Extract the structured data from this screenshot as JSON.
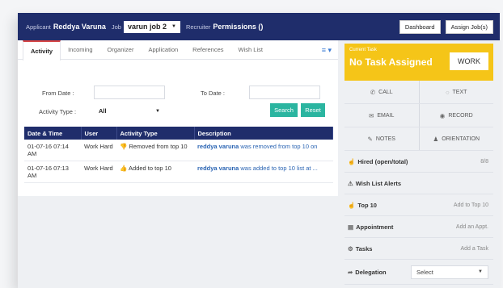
{
  "header": {
    "applicant_label": "Applicant",
    "applicant_name": "Reddya Varuna",
    "job_label": "Job",
    "job_value": "varun job 2",
    "recruiter_label": "Recruiter",
    "recruiter_value": "Permissions ()",
    "dashboard_button": "Dashboard",
    "assign_button": "Assign Job(s)"
  },
  "tabs": [
    "Activity",
    "Incoming",
    "Organizer",
    "Application",
    "References",
    "Wish List"
  ],
  "filters": {
    "from_label": "From Date :",
    "to_label": "To Date :",
    "type_label": "Activity Type :",
    "type_value": "All",
    "search_button": "Search",
    "reset_button": "Reset"
  },
  "table": {
    "columns": [
      "Date & Time",
      "User",
      "Activity Type",
      "Description"
    ],
    "rows": [
      {
        "date": "01-07-16 07:14 AM",
        "user": "Work Hard",
        "type": "Removed from top 10",
        "desc_user": "reddya varuna",
        "desc_text": " was removed from top 10 on"
      },
      {
        "date": "01-07-16 07:13 AM",
        "user": "Work Hard",
        "type": "Added to top 10",
        "desc_user": "reddya varuna",
        "desc_text": " was added to top 10 list at ..."
      }
    ]
  },
  "task": {
    "current_label": "Current Task",
    "title": "No Task Assigned",
    "work_button": "WORK"
  },
  "actions": {
    "call": "CALL",
    "text": "TEXT",
    "email": "EMAIL",
    "record": "RECORD",
    "notes": "NOTES",
    "orientation": "ORIENTATION"
  },
  "panels": {
    "hired_label": "Hired (open/total)",
    "hired_value": "8/8",
    "wishlist_label": "Wish List Alerts",
    "top10_label": "Top 10",
    "top10_action": "Add to Top 10",
    "appointment_label": "Appointment",
    "appointment_action": "Add an Appt.",
    "tasks_label": "Tasks",
    "tasks_action": "Add a Task",
    "delegation_label": "Delegation",
    "delegation_value": "Select"
  },
  "colors": {
    "navy": "#1f2d6b",
    "teal": "#2bb5a0",
    "yellow": "#f5c518",
    "link": "#2a64b3"
  }
}
